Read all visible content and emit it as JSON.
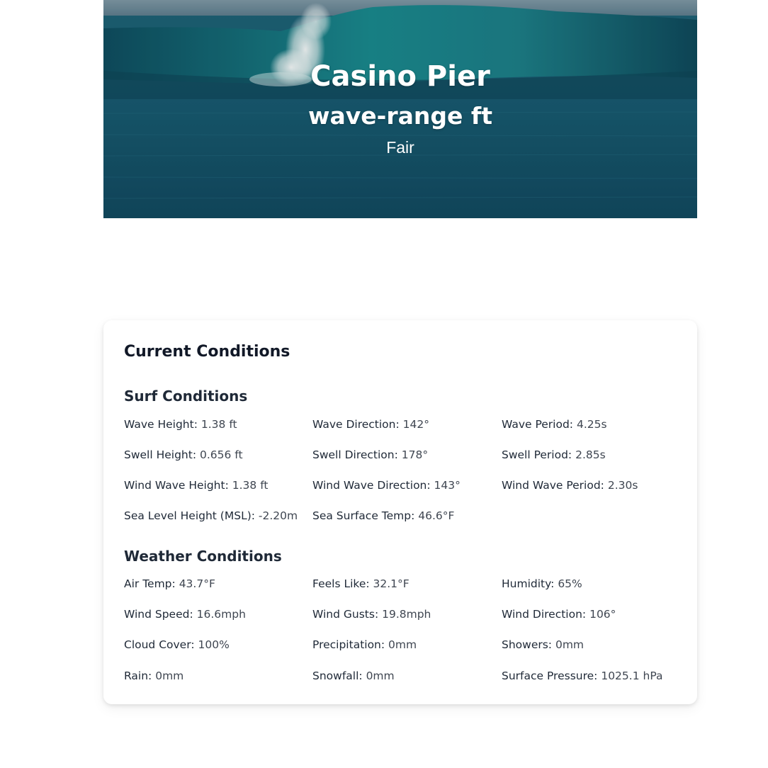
{
  "hero": {
    "spot_name": "Casino Pier",
    "wave_range": "wave-range ft",
    "rating": "Fair"
  },
  "card": {
    "title": "Current Conditions",
    "surf": {
      "title": "Surf Conditions",
      "items": [
        {
          "label": "Wave Height:",
          "value": "1.38 ft"
        },
        {
          "label": "Wave Direction:",
          "value": "142°"
        },
        {
          "label": "Wave Period:",
          "value": "4.25s"
        },
        {
          "label": "Swell Height:",
          "value": "0.656 ft"
        },
        {
          "label": "Swell Direction:",
          "value": "178°"
        },
        {
          "label": "Swell Period:",
          "value": "2.85s"
        },
        {
          "label": "Wind Wave Height:",
          "value": "1.38 ft"
        },
        {
          "label": "Wind Wave Direction:",
          "value": "143°"
        },
        {
          "label": "Wind Wave Period:",
          "value": "2.30s"
        },
        {
          "label": "Sea Level Height (MSL):",
          "value": "-2.20m"
        },
        {
          "label": "Sea Surface Temp:",
          "value": "46.6°F"
        }
      ]
    },
    "weather": {
      "title": "Weather Conditions",
      "items": [
        {
          "label": "Air Temp:",
          "value": "43.7°F"
        },
        {
          "label": "Feels Like:",
          "value": "32.1°F"
        },
        {
          "label": "Humidity:",
          "value": "65%"
        },
        {
          "label": "Wind Speed:",
          "value": "16.6mph"
        },
        {
          "label": "Wind Gusts:",
          "value": "19.8mph"
        },
        {
          "label": "Wind Direction:",
          "value": "106°"
        },
        {
          "label": "Cloud Cover:",
          "value": "100%"
        },
        {
          "label": "Precipitation:",
          "value": "0mm"
        },
        {
          "label": "Showers:",
          "value": "0mm"
        },
        {
          "label": "Rain:",
          "value": "0mm"
        },
        {
          "label": "Snowfall:",
          "value": "0mm"
        },
        {
          "label": "Surface Pressure:",
          "value": "1025.1 hPa"
        }
      ]
    }
  }
}
